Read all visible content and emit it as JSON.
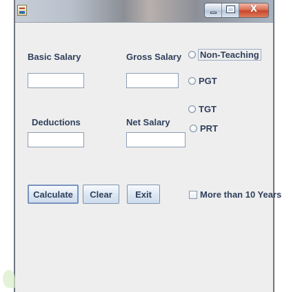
{
  "window": {
    "title": "",
    "controls": {
      "minimize": "minimize-icon",
      "maximize": "maximize-icon",
      "close_label": "X"
    }
  },
  "form": {
    "basic_salary_label": "Basic Salary",
    "gross_salary_label": "Gross Salary",
    "deductions_label": "Deductions",
    "net_salary_label": "Net Salary",
    "basic_salary_value": "",
    "gross_salary_value": "",
    "deductions_value": "",
    "net_salary_value": ""
  },
  "radio_options": [
    {
      "label": "Non-Teaching",
      "selected": false
    },
    {
      "label": "PGT",
      "selected": false
    },
    {
      "label": "TGT",
      "selected": false
    },
    {
      "label": "PRT",
      "selected": false
    }
  ],
  "buttons": {
    "calculate": "Calculate",
    "clear": "Clear",
    "exit": "Exit"
  },
  "checkbox": {
    "label": "More than 10 Years",
    "checked": false
  }
}
